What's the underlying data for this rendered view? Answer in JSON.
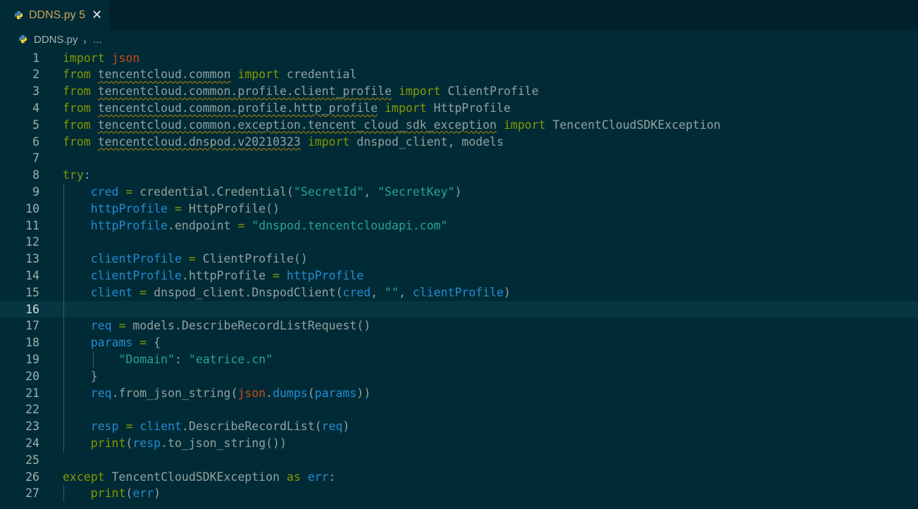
{
  "tab": {
    "filename": "DDNS.py",
    "problems": "5",
    "close_glyph": "✕",
    "icon": "python-icon"
  },
  "breadcrumb": {
    "file": "DDNS.py",
    "separator": "›",
    "more": "..."
  },
  "editor": {
    "current_line": 16,
    "lines": [
      {
        "n": "1",
        "tokens": [
          [
            "kw",
            "import"
          ],
          [
            "plain",
            " "
          ],
          [
            "json",
            "json"
          ]
        ]
      },
      {
        "n": "2",
        "tokens": [
          [
            "kw",
            "from"
          ],
          [
            "plain",
            " "
          ],
          [
            "modsq",
            "tencentcloud.common"
          ],
          [
            "plain",
            " "
          ],
          [
            "kw",
            "import"
          ],
          [
            "plain",
            " credential"
          ]
        ]
      },
      {
        "n": "3",
        "tokens": [
          [
            "kw",
            "from"
          ],
          [
            "plain",
            " "
          ],
          [
            "modsq",
            "tencentcloud.common.profile.client_profile"
          ],
          [
            "plain",
            " "
          ],
          [
            "kw",
            "import"
          ],
          [
            "plain",
            " ClientProfile"
          ]
        ]
      },
      {
        "n": "4",
        "tokens": [
          [
            "kw",
            "from"
          ],
          [
            "plain",
            " "
          ],
          [
            "modsq",
            "tencentcloud.common.profile.http_profile"
          ],
          [
            "plain",
            " "
          ],
          [
            "kw",
            "import"
          ],
          [
            "plain",
            " HttpProfile"
          ]
        ]
      },
      {
        "n": "5",
        "tokens": [
          [
            "kw",
            "from"
          ],
          [
            "plain",
            " "
          ],
          [
            "modsq",
            "tencentcloud.common.exception.tencent_cloud_sdk_exception"
          ],
          [
            "plain",
            " "
          ],
          [
            "kw",
            "import"
          ],
          [
            "plain",
            " TencentCloudSDKException"
          ]
        ]
      },
      {
        "n": "6",
        "tokens": [
          [
            "kw",
            "from"
          ],
          [
            "plain",
            " "
          ],
          [
            "modsq",
            "tencentcloud.dnspod.v20210323"
          ],
          [
            "plain",
            " "
          ],
          [
            "kw",
            "import"
          ],
          [
            "plain",
            " dnspod_client, models"
          ]
        ]
      },
      {
        "n": "7",
        "tokens": []
      },
      {
        "n": "8",
        "tokens": [
          [
            "kw",
            "try"
          ],
          [
            "plain",
            ":"
          ]
        ]
      },
      {
        "n": "9",
        "tokens": [
          [
            "plain",
            "    "
          ],
          [
            "var",
            "cred"
          ],
          [
            "plain",
            " "
          ],
          [
            "kw",
            "="
          ],
          [
            "plain",
            " credential.Credential("
          ],
          [
            "str",
            "\"SecretId\""
          ],
          [
            "plain",
            ", "
          ],
          [
            "str",
            "\"SecretKey\""
          ],
          [
            "plain",
            ")"
          ]
        ]
      },
      {
        "n": "10",
        "tokens": [
          [
            "plain",
            "    "
          ],
          [
            "var",
            "httpProfile"
          ],
          [
            "plain",
            " "
          ],
          [
            "kw",
            "="
          ],
          [
            "plain",
            " HttpProfile()"
          ]
        ]
      },
      {
        "n": "11",
        "tokens": [
          [
            "plain",
            "    "
          ],
          [
            "var",
            "httpProfile"
          ],
          [
            "plain",
            ".endpoint "
          ],
          [
            "kw",
            "="
          ],
          [
            "plain",
            " "
          ],
          [
            "str",
            "\"dnspod.tencentcloudapi.com\""
          ]
        ]
      },
      {
        "n": "12",
        "tokens": []
      },
      {
        "n": "13",
        "tokens": [
          [
            "plain",
            "    "
          ],
          [
            "var",
            "clientProfile"
          ],
          [
            "plain",
            " "
          ],
          [
            "kw",
            "="
          ],
          [
            "plain",
            " ClientProfile()"
          ]
        ]
      },
      {
        "n": "14",
        "tokens": [
          [
            "plain",
            "    "
          ],
          [
            "var",
            "clientProfile"
          ],
          [
            "plain",
            ".httpProfile "
          ],
          [
            "kw",
            "="
          ],
          [
            "plain",
            " "
          ],
          [
            "var",
            "httpProfile"
          ]
        ]
      },
      {
        "n": "15",
        "tokens": [
          [
            "plain",
            "    "
          ],
          [
            "var",
            "client"
          ],
          [
            "plain",
            " "
          ],
          [
            "kw",
            "="
          ],
          [
            "plain",
            " dnspod_client.DnspodClient("
          ],
          [
            "var",
            "cred"
          ],
          [
            "plain",
            ", "
          ],
          [
            "str",
            "\"\""
          ],
          [
            "plain",
            ", "
          ],
          [
            "var",
            "clientProfile"
          ],
          [
            "plain",
            ")"
          ]
        ]
      },
      {
        "n": "16",
        "tokens": []
      },
      {
        "n": "17",
        "tokens": [
          [
            "plain",
            "    "
          ],
          [
            "var",
            "req"
          ],
          [
            "plain",
            " "
          ],
          [
            "kw",
            "="
          ],
          [
            "plain",
            " models.DescribeRecordListRequest()"
          ]
        ]
      },
      {
        "n": "18",
        "tokens": [
          [
            "plain",
            "    "
          ],
          [
            "var",
            "params"
          ],
          [
            "plain",
            " "
          ],
          [
            "kw",
            "="
          ],
          [
            "plain",
            " {"
          ]
        ]
      },
      {
        "n": "19",
        "tokens": [
          [
            "plain",
            "        "
          ],
          [
            "str",
            "\"Domain\""
          ],
          [
            "plain",
            ": "
          ],
          [
            "str",
            "\"eatrice.cn\""
          ]
        ]
      },
      {
        "n": "20",
        "tokens": [
          [
            "plain",
            "    }"
          ]
        ]
      },
      {
        "n": "21",
        "tokens": [
          [
            "plain",
            "    "
          ],
          [
            "var",
            "req"
          ],
          [
            "plain",
            ".from_json_string("
          ],
          [
            "json",
            "json"
          ],
          [
            "plain",
            "."
          ],
          [
            "var",
            "dumps"
          ],
          [
            "plain",
            "("
          ],
          [
            "var",
            "params"
          ],
          [
            "plain",
            "))"
          ]
        ]
      },
      {
        "n": "22",
        "tokens": []
      },
      {
        "n": "23",
        "tokens": [
          [
            "plain",
            "    "
          ],
          [
            "var",
            "resp"
          ],
          [
            "plain",
            " "
          ],
          [
            "kw",
            "="
          ],
          [
            "plain",
            " "
          ],
          [
            "var",
            "client"
          ],
          [
            "plain",
            ".DescribeRecordList("
          ],
          [
            "var",
            "req"
          ],
          [
            "plain",
            ")"
          ]
        ]
      },
      {
        "n": "24",
        "tokens": [
          [
            "plain",
            "    "
          ],
          [
            "kw",
            "print"
          ],
          [
            "plain",
            "("
          ],
          [
            "var",
            "resp"
          ],
          [
            "plain",
            ".to_json_string())"
          ]
        ]
      },
      {
        "n": "25",
        "tokens": []
      },
      {
        "n": "26",
        "tokens": [
          [
            "kw",
            "except"
          ],
          [
            "plain",
            " TencentCloudSDKException "
          ],
          [
            "kw",
            "as"
          ],
          [
            "plain",
            " "
          ],
          [
            "var",
            "err"
          ],
          [
            "plain",
            ":"
          ]
        ]
      },
      {
        "n": "27",
        "tokens": [
          [
            "plain",
            "    "
          ],
          [
            "kw",
            "print"
          ],
          [
            "plain",
            "("
          ],
          [
            "var",
            "err"
          ],
          [
            "plain",
            ")"
          ]
        ]
      }
    ]
  },
  "colors": {
    "background": "#002b36",
    "keyword": "#859900",
    "variable": "#268bd2",
    "string": "#2aa198",
    "builtin": "#cb4b16",
    "text": "#93a1a1",
    "tab_label": "#d0a45c",
    "squiggle": "#b58900"
  }
}
